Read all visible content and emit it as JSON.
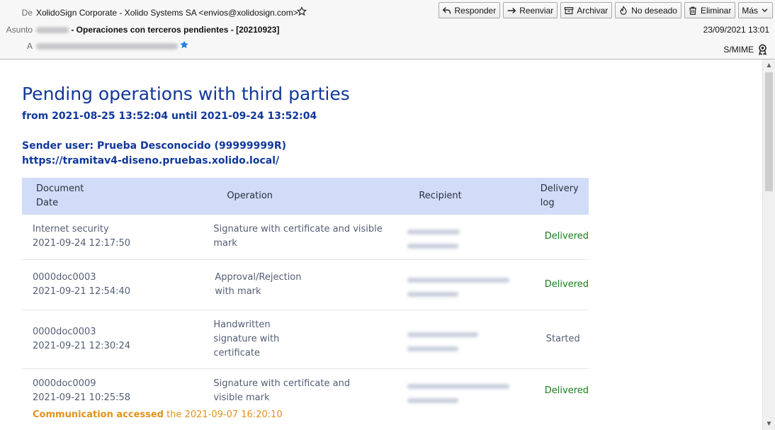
{
  "header": {
    "from_label": "De",
    "from_value": "XolidoSign Corporate - Xolido Systems SA <envios@xolidosign.com>",
    "subject_label": "Asunto",
    "subject_value": "- Operaciones con terceros pendientes - [20210923]",
    "to_label": "A",
    "date": "23/09/2021 13:01",
    "smime_label": "S/MIME"
  },
  "toolbar": {
    "reply": "Responder",
    "forward": "Reenviar",
    "archive": "Archivar",
    "junk": "No deseado",
    "delete": "Eliminar",
    "more": "Más"
  },
  "message": {
    "title": "Pending operations with third parties",
    "range": "from 2021-08-25 13:52:04 until 2021-09-24 13:52:04",
    "sender": "Sender user: Prueba Desconocido (99999999R)",
    "url": "https://tramitav4-diseno.pruebas.xolido.local/",
    "columns": {
      "document_line1": "Document",
      "document_line2": "Date",
      "operation": "Operation",
      "recipient": "Recipient",
      "log_line1": "Delivery",
      "log_line2": "log"
    },
    "rows": [
      {
        "document": "Internet security",
        "date": "2021-09-24 12:17:50",
        "operation_l1": "Signature with certificate and visible",
        "operation_l2": "mark",
        "operation_l3": "",
        "status": "Delivered"
      },
      {
        "document": "0000doc0003",
        "date": "2021-09-21 12:54:40",
        "operation_l1": "Approval/Rejection",
        "operation_l2": "with mark",
        "operation_l3": "",
        "status": "Delivered"
      },
      {
        "document": "0000doc0003",
        "date": "2021-09-21 12:30:24",
        "operation_l1": "Handwritten",
        "operation_l2": "signature with",
        "operation_l3": "certificate",
        "status": "Started"
      },
      {
        "document": "0000doc0009",
        "date": "2021-09-21 10:25:58",
        "operation_l1": "Signature with certificate and",
        "operation_l2": "visible mark",
        "operation_l3": "",
        "status": "Delivered"
      }
    ],
    "accessed_label": "Communication accessed",
    "accessed_date": "the 2021-09-07 16:20:10"
  },
  "colors": {
    "title_blue": "#10379a",
    "header_row": "#d1dcf8",
    "delivered_green": "#1a7d1a",
    "accessed_orange": "#e0921a"
  }
}
